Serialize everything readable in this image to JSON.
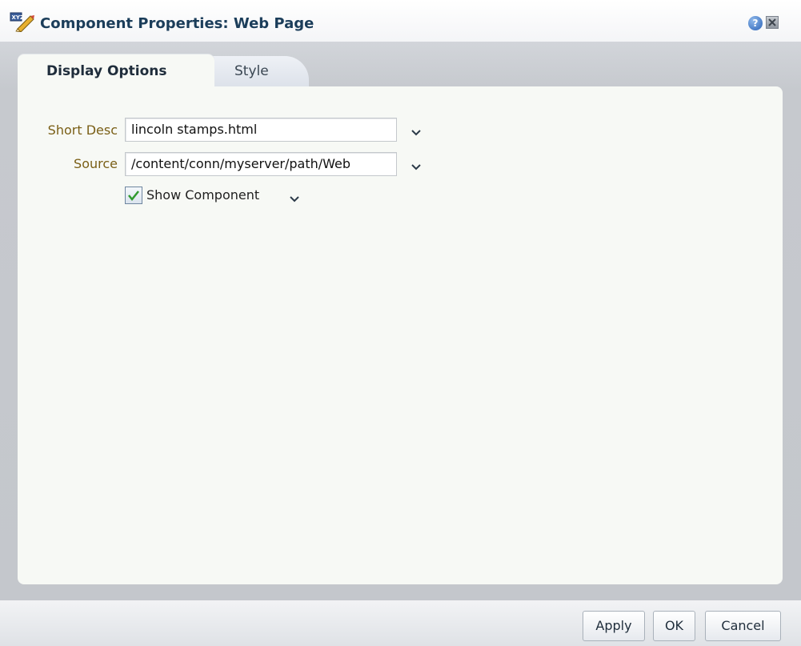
{
  "dialog": {
    "title": "Component Properties: Web Page",
    "title_icon": "edit-properties-icon",
    "help_icon": "help-icon",
    "help_glyph": "?",
    "close_icon": "close-icon"
  },
  "tabs": [
    {
      "label": "Display Options",
      "active": true
    },
    {
      "label": "Style",
      "active": false
    }
  ],
  "form": {
    "short_desc": {
      "label": "Short Desc",
      "value": "lincoln stamps.html"
    },
    "source": {
      "label": "Source",
      "value": "/content/conn/myserver/path/Web"
    },
    "show_component": {
      "label": "Show Component",
      "checked": true
    }
  },
  "buttons": {
    "apply": "Apply",
    "ok": "OK",
    "cancel": "Cancel"
  },
  "colors": {
    "title_text": "#1b3d5a",
    "field_label": "#7a5f16",
    "check_mark": "#2f9a2f"
  }
}
